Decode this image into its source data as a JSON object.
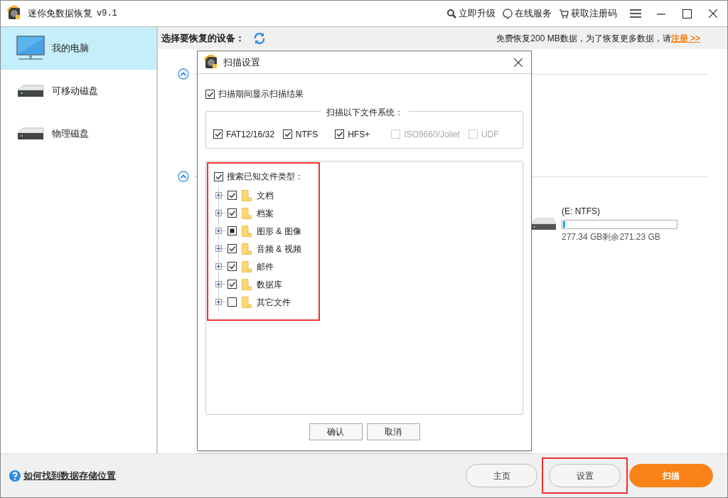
{
  "window": {
    "title": "迷你免数据恢复",
    "version": "v9.1",
    "actions": [
      {
        "kind": "search",
        "label": "立即升级"
      },
      {
        "kind": "chat",
        "label": "在线服务"
      },
      {
        "kind": "cart",
        "label": "获取注册码"
      }
    ]
  },
  "sidebar": {
    "items": [
      {
        "kind": "computer",
        "label": "我的电脑",
        "selected": true
      },
      {
        "kind": "drive",
        "label": "可移动磁盘",
        "selected": false
      },
      {
        "kind": "drive",
        "label": "物理磁盘",
        "selected": false
      }
    ]
  },
  "header": {
    "title": "选择要恢复的设备：",
    "notice": "免费恢复200 MB数据，为了恢复更多数据，请",
    "register_link": "注册 >>"
  },
  "drive": {
    "name": "(E: NTFS)",
    "level": 0.02,
    "size": "277.34 GB剩余271.23 GB"
  },
  "dialog": {
    "title": "扫描设置",
    "show_results": {
      "label": "扫描期间显示扫描结果",
      "checked": true
    },
    "file_systems": {
      "legend": "扫描以下文件系统：",
      "items": [
        {
          "label": "FAT12/16/32",
          "checked": true,
          "disabled": false
        },
        {
          "label": "NTFS",
          "checked": true,
          "disabled": false
        },
        {
          "label": "HFS+",
          "checked": true,
          "disabled": false
        },
        {
          "label": "ISO9660/Joliet",
          "checked": false,
          "disabled": true
        },
        {
          "label": "UDF",
          "checked": false,
          "disabled": true
        }
      ]
    },
    "file_types": {
      "label": "搜索已知文件类型：",
      "checked": true,
      "highlighted": true,
      "items": [
        {
          "label": "文档",
          "checked": true,
          "partial": false
        },
        {
          "label": "档案",
          "checked": true,
          "partial": false
        },
        {
          "label": "图形 & 图像",
          "checked": true,
          "partial": true
        },
        {
          "label": "音频 & 视频",
          "checked": true,
          "partial": false
        },
        {
          "label": "邮件",
          "checked": true,
          "partial": false
        },
        {
          "label": "数据库",
          "checked": true,
          "partial": false
        },
        {
          "label": "其它文件",
          "checked": false,
          "partial": false
        }
      ]
    },
    "buttons": [
      "确认",
      "取消"
    ]
  },
  "footer": {
    "help_link": "如何找到数据存储位置",
    "buttons": [
      {
        "label": "主页",
        "kind": "normal",
        "highlighted": false
      },
      {
        "label": "设置",
        "kind": "normal",
        "highlighted": true
      },
      {
        "label": "扫描",
        "kind": "primary",
        "highlighted": false
      }
    ]
  }
}
